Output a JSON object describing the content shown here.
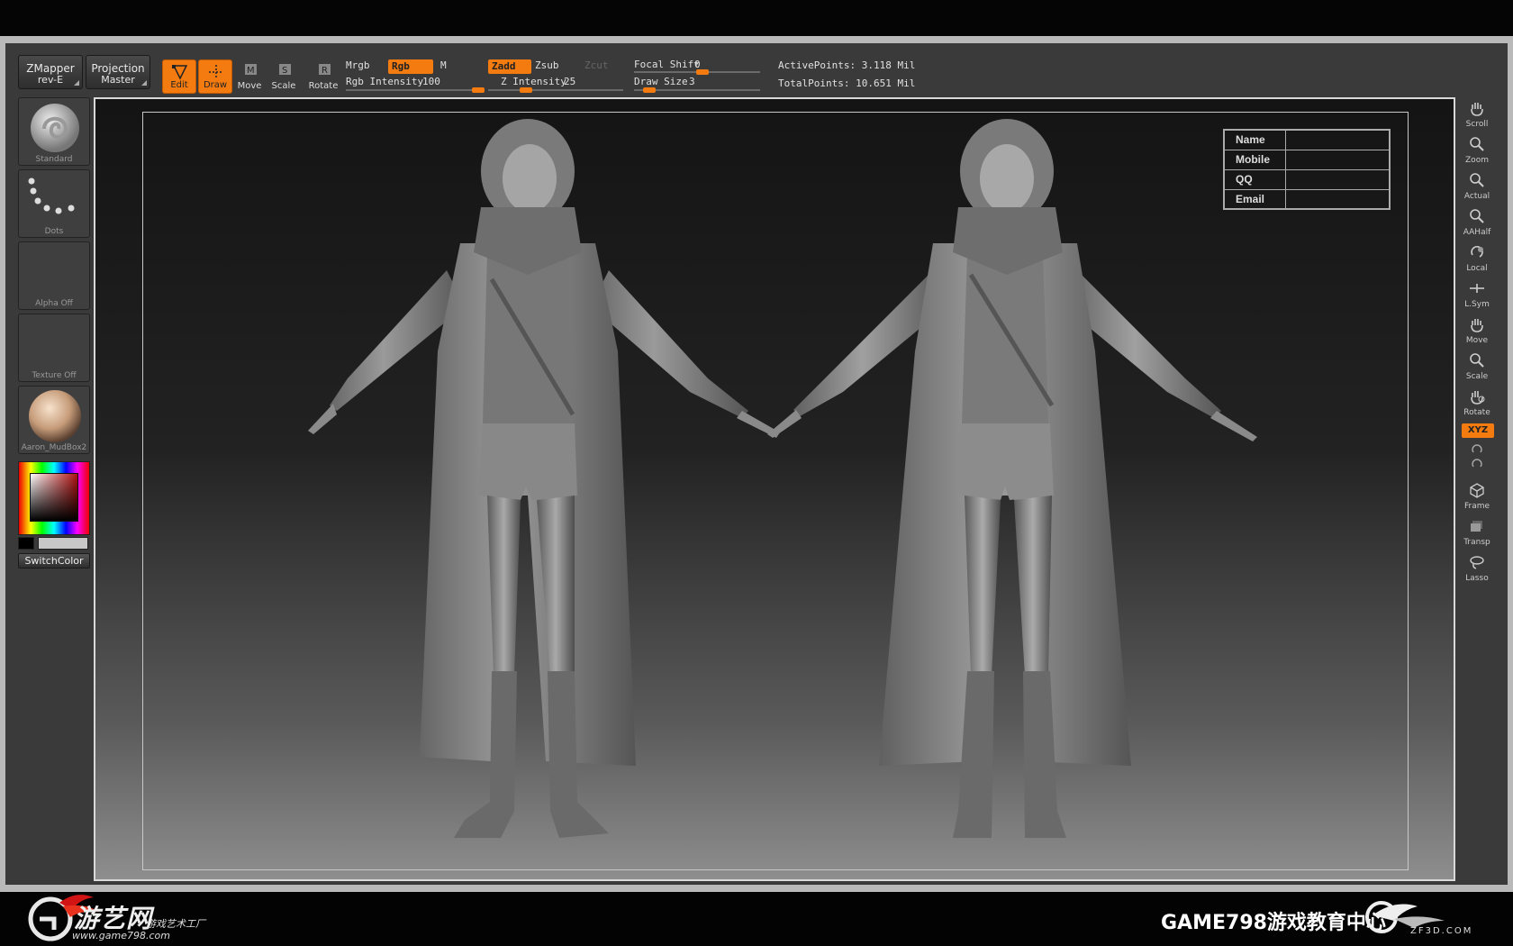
{
  "toolbar": {
    "zmapper": {
      "title": "ZMapper",
      "sub": "rev-E"
    },
    "projection": {
      "title": "Projection",
      "sub": "Master"
    },
    "tools": [
      {
        "label": "Edit",
        "active": true,
        "icon": "edit-icon"
      },
      {
        "label": "Draw",
        "active": true,
        "icon": "draw-icon"
      },
      {
        "label": "Move",
        "active": false,
        "icon": "move-icon"
      },
      {
        "label": "Scale",
        "active": false,
        "icon": "scale-icon"
      },
      {
        "label": "Rotate",
        "active": false,
        "icon": "rotate-icon"
      }
    ],
    "mrgb": "Mrgb",
    "rgb": "Rgb",
    "m": "M",
    "rgb_intensity_label": "Rgb Intensity",
    "rgb_intensity_value": "100",
    "zadd": "Zadd",
    "zsub": "Zsub",
    "zcut": "Zcut",
    "z_intensity_label": "Z Intensity",
    "z_intensity_value": "25",
    "focal_shift_label": "Focal Shift",
    "focal_shift_value": "0",
    "draw_size_label": "Draw Size",
    "draw_size_value": "3",
    "active_points": "ActivePoints: 3.118 Mil",
    "total_points": "TotalPoints: 10.651 Mil"
  },
  "left_shelf": {
    "brush": "Standard",
    "stroke": "Dots",
    "alpha": "Alpha  Off",
    "texture": "Texture  Off",
    "material": "Aaron_MudBox2",
    "switch_color": "SwitchColor"
  },
  "info_table": [
    {
      "key": "Name",
      "value": ""
    },
    {
      "key": "Mobile",
      "value": ""
    },
    {
      "key": "QQ",
      "value": ""
    },
    {
      "key": "Email",
      "value": ""
    }
  ],
  "right_shelf": [
    {
      "label": "Scroll",
      "icon": "hand-icon"
    },
    {
      "label": "Zoom",
      "icon": "zoom-icon"
    },
    {
      "label": "Actual",
      "icon": "actual-icon"
    },
    {
      "label": "AAHalf",
      "icon": "aahalf-icon"
    },
    {
      "label": "Local",
      "icon": "local-icon"
    },
    {
      "label": "L.Sym",
      "icon": "lsym-icon"
    },
    {
      "label": "Move",
      "icon": "move-icon"
    },
    {
      "label": "Scale",
      "icon": "scale-icon"
    },
    {
      "label": "Rotate",
      "icon": "rotate-icon"
    },
    {
      "label": "Frame",
      "icon": "frame-icon"
    },
    {
      "label": "Transp",
      "icon": "transp-icon"
    },
    {
      "label": "Lasso",
      "icon": "lasso-icon"
    }
  ],
  "xyz": "XYZ",
  "footer": {
    "brand_cn": "游艺网",
    "brand_sub": "游戏艺术工厂",
    "brand_url": "www.game798.com",
    "right_text": "GAME798游戏教育中心",
    "zf_url": "ZF3D.COM"
  },
  "colors": {
    "accent": "#f37b10",
    "panel": "#3a3a3a",
    "frame": "#b9b9b9"
  }
}
